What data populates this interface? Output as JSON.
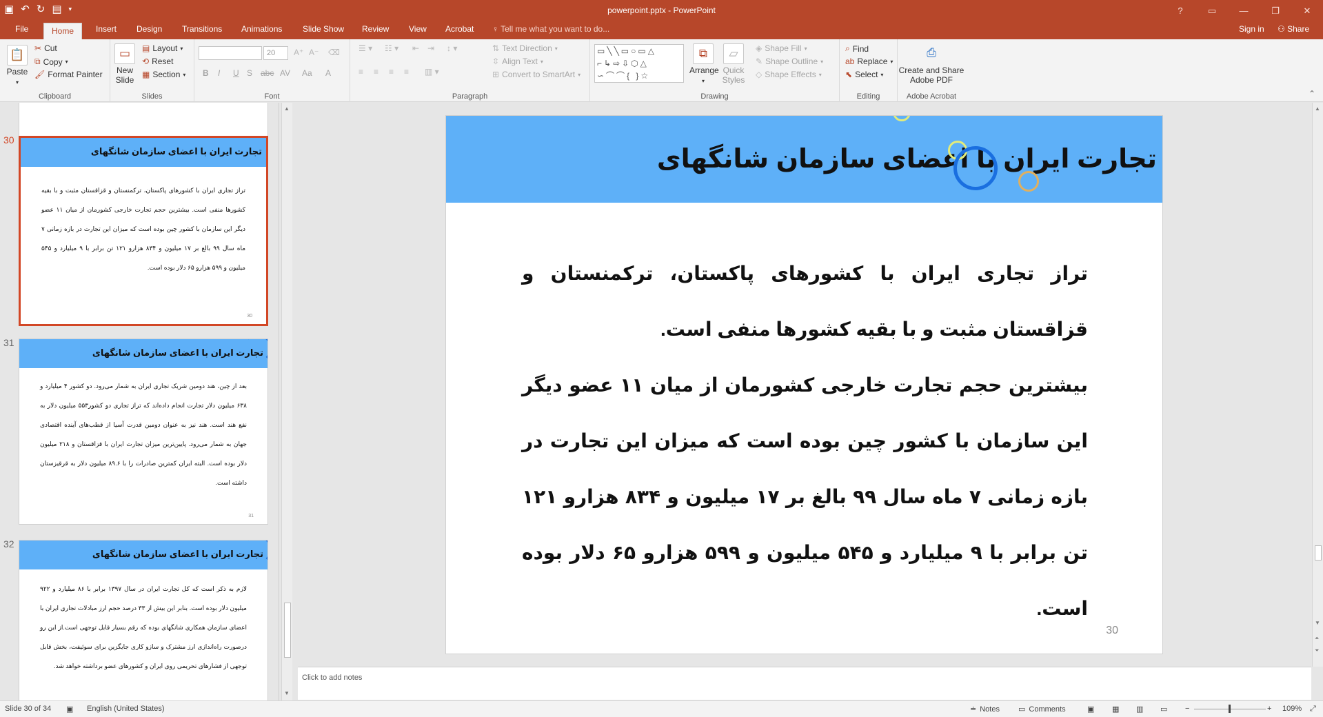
{
  "window": {
    "title": "powerpoint.pptx - PowerPoint",
    "controls": [
      "?",
      "▭",
      "—",
      "❐",
      "✕"
    ]
  },
  "tabs": [
    "File",
    "Home",
    "Insert",
    "Design",
    "Transitions",
    "Animations",
    "Slide Show",
    "Review",
    "View",
    "Acrobat"
  ],
  "tell_me": "Tell me what you want to do...",
  "sign_in": "Sign in",
  "share": "Share",
  "ribbon": {
    "clipboard": {
      "paste": "Paste",
      "cut": "Cut",
      "copy": "Copy",
      "format_painter": "Format Painter",
      "label": "Clipboard"
    },
    "slides": {
      "new_slide_line1": "New",
      "new_slide_line2": "Slide",
      "layout": "Layout",
      "reset": "Reset",
      "section": "Section",
      "label": "Slides"
    },
    "font": {
      "size": "20",
      "label": "Font",
      "bold": "B",
      "italic": "I",
      "underline": "U",
      "strike": "S",
      "shadow": "abc",
      "spacing": "AV",
      "case": "Aa",
      "color": "A"
    },
    "paragraph": {
      "text_direction": "Text Direction",
      "align_text": "Align Text",
      "convert_smartart": "Convert to SmartArt",
      "label": "Paragraph"
    },
    "drawing": {
      "arrange": "Arrange",
      "quick_styles_line1": "Quick",
      "quick_styles_line2": "Styles",
      "shape_fill": "Shape Fill",
      "shape_outline": "Shape Outline",
      "shape_effects": "Shape Effects",
      "label": "Drawing"
    },
    "editing": {
      "find": "Find",
      "replace": "Replace",
      "select": "Select",
      "label": "Editing"
    },
    "acrobat": {
      "create_line1": "Create and Share",
      "create_line2": "Adobe PDF",
      "label": "Adobe Acrobat"
    }
  },
  "thumbnails": {
    "partial_page_number": "29",
    "slides": [
      {
        "number": "30",
        "title": "تجارت ایران با اعضای سازمان شانگهای",
        "body": "تراز تجاری ایران با کشورهای پاکستان، ترکمنستان و قزاقستان مثبت و با بقیه کشورها منفی است. بیشترین حجم تجارت خارجی کشورمان از میان ۱۱ عضو دیگر این سازمان با کشور چین بوده است که میزان این تجارت در بازه زمانی ۷ ماه سال ۹۹ بالغ بر ۱۷ میلیون و ۸۳۴ هزارو ۱۲۱ تن برابر با ۹ میلیارد و ۵۴۵ میلیون و ۵۹۹ هزارو ۶۵ دلار بوده است.",
        "page_number": "30"
      },
      {
        "number": "31",
        "title": "تجارت ایران با اعضای سازمان شانگهای",
        "body": "بعد از چین، هند دومین شریک تجاری ایران به شمار می‌رود. دو کشور ۴ میلیارد و ۶۳۸ میلیون دلار تجارت انجام داده‌اند که تراز تجاری دو کشور۵۵۳ میلیون دلار به نفع هند است. هند نیز به عنوان دومین قدرت آسیا از قطب‌های آینده اقتصادی جهان به شمار می‌رود. پایین‌ترین میزان تجارت ایران با قزاقستان و ۲۱۸ میلیون دلار بوده است. البته ایران کمترین صادرات را با ۸۹.۶ میلیون دلار به قرقیزستان داشته است.",
        "page_number": "31"
      },
      {
        "number": "32",
        "title": "تجارت ایران با اعضای سازمان شانگهای",
        "body": "لازم به ذکر است که کل تجارت ایران در سال ۱۳۹۷ برابر با ۸۶ میلیارد و ۹۲۲ میلیون دلار بوده است. بنابر این بیش از ۳۳ درصد حجم ارز مبادلات تجاری ایران با اعضای سازمان همکاری شانگهای بوده که رقم بسیار قابل توجهی است.از این رو درصورت راه‌اندازی ارز مشترک و سازو کاری جایگزین برای سوئیفت، بخش قابل توجهی از فشارهای تحریمی روی ایران و کشورهای عضو برداشته خواهد شد.",
        "page_number": "32"
      }
    ]
  },
  "slide": {
    "title": "تجارت ایران با اعضای سازمان شانگهای",
    "paragraphs": [
      "تراز تجاری ایران با کشورهای پاکستان، ترکمنستان و قزاقستان مثبت و با بقیه کشورها منفی است.",
      "بیشترین حجم تجارت خارجی کشورمان از میان ۱۱ عضو دیگر این سازمان با کشور چین بوده است که میزان این تجارت در بازه زمانی ۷ ماه سال ۹۹ بالغ بر ۱۷ میلیون و ۸۳۴ هزارو ۱۲۱ تن برابر با ۹ میلیارد و ۵۴۵ میلیون و ۵۹۹ هزارو ۶۵ دلار بوده است."
    ],
    "page_number": "30",
    "accent_color": "#5eb0f8"
  },
  "notes_placeholder": "Click to add notes",
  "status": {
    "slide_indicator": "Slide 30 of 34",
    "language": "English (United States)",
    "notes": "Notes",
    "comments": "Comments",
    "zoom": "109%"
  },
  "colors": {
    "brand": "#b7472a",
    "selection": "#d24726",
    "slide_header": "#5eb0f8"
  }
}
